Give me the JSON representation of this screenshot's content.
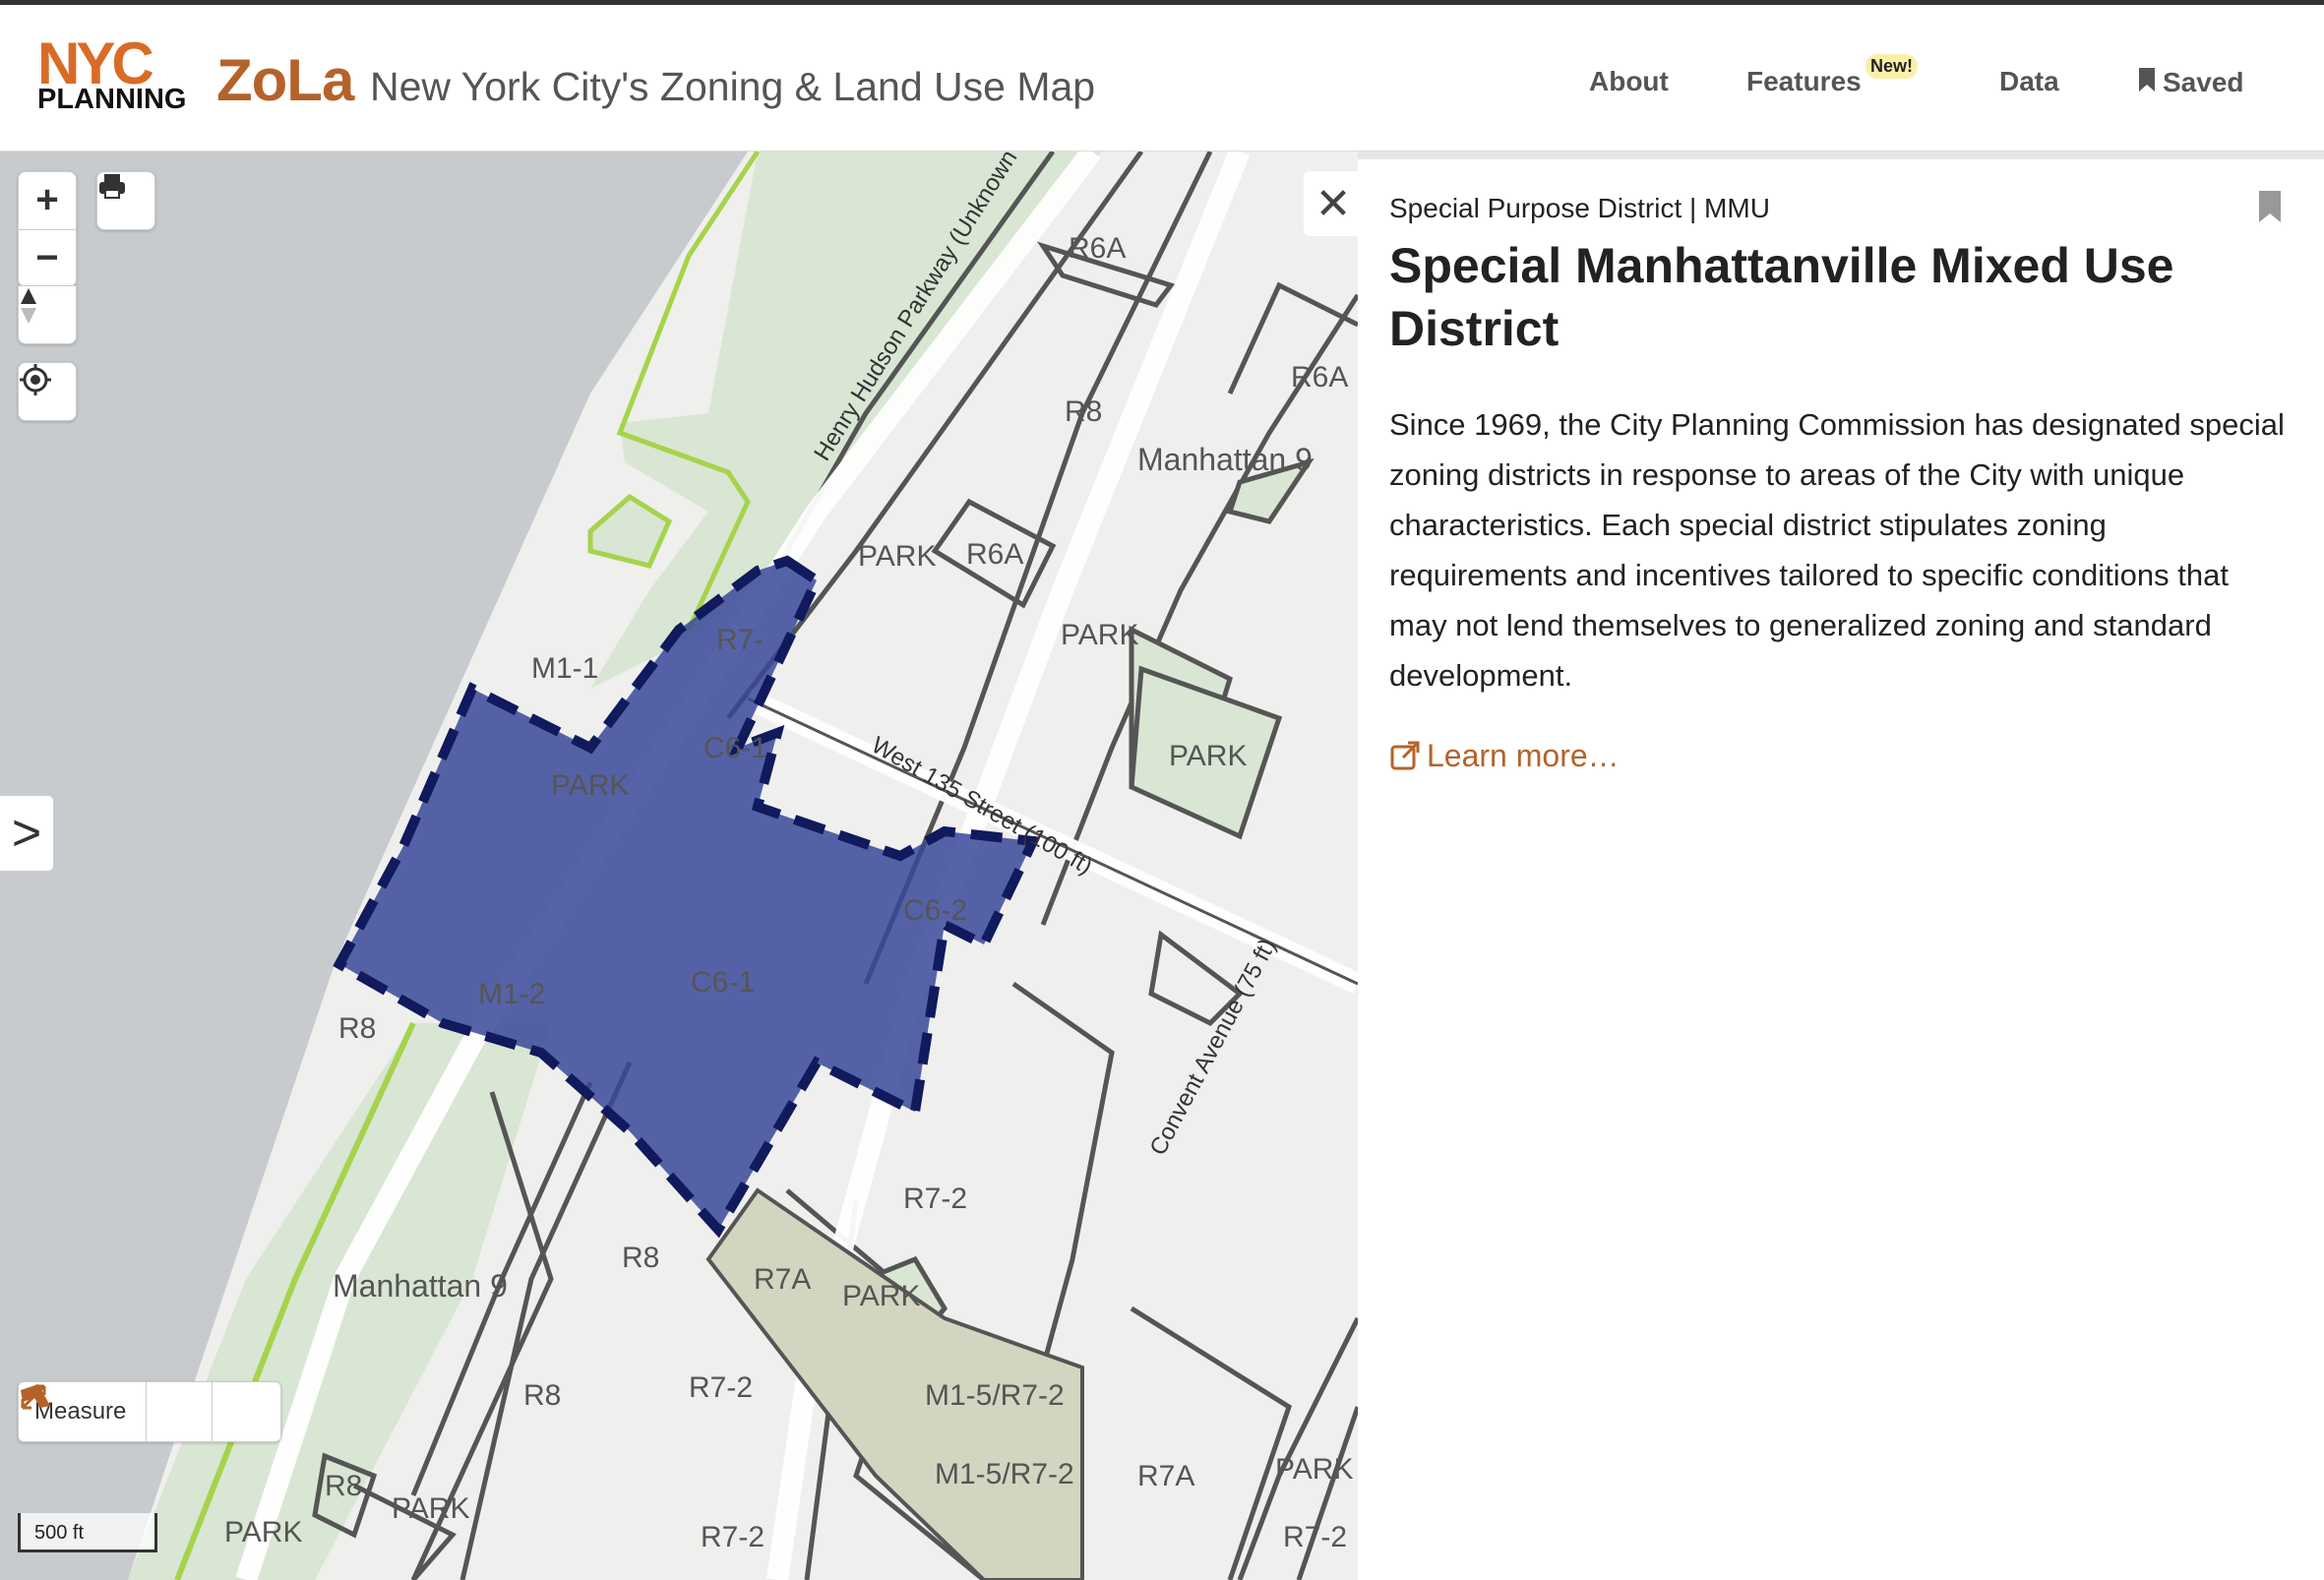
{
  "header": {
    "logo_nyc": "NYC",
    "logo_planning": "PLANNING",
    "app_name": "ZoLa",
    "app_subtitle": "New York City's Zoning & Land Use Map",
    "nav": {
      "about": "About",
      "features": "Features",
      "features_badge": "New!",
      "data": "Data",
      "saved": "Saved"
    }
  },
  "map": {
    "controls": {
      "zoom_in": "+",
      "zoom_out": "−",
      "side_toggle": ">"
    },
    "measure": {
      "label": "Measure"
    },
    "scale": "500 ft",
    "labels": {
      "r6a_1": "R6A",
      "r6a_2": "R6A",
      "r6a_3": "R6A",
      "r8_1": "R8",
      "r8_2": "R8",
      "r8_3": "R8",
      "r8_4": "R8",
      "r8_5": "R8",
      "manhattan9_1": "Manhattan 9",
      "manhattan9_2": "Manhattan 9",
      "park_1": "PARK",
      "park_2": "PARK",
      "park_3": "PARK",
      "park_4": "PARK",
      "park_5": "PARK",
      "park_6": "PARK",
      "park_7": "PARK",
      "park_8": "PARK",
      "m1_1": "M1-1",
      "m1_2": "M1-2",
      "c6_1a": "C6-1",
      "c6_1b": "C6-1",
      "c6_2": "C6-2",
      "r7_2a": "R7-2",
      "r7_2b": "R7-2",
      "r7_2c": "R7-2",
      "r7_2d": "R7-2",
      "r7_top": "R7-",
      "r7a_1": "R7A",
      "r7a_2": "R7A",
      "m15_1": "M1-5/R7-2",
      "m15_2": "M1-5/R7-2",
      "hhp": "Henry Hudson Parkway  (Unknown",
      "w135": "West 135 Street  (100 ft)",
      "convent": "Convent Avenue  (75 ft)"
    },
    "colors": {
      "district_fill": "#3a4899",
      "district_border": "#101a5c",
      "park_fill": "#d8e6d3",
      "river": "#c8cbce"
    }
  },
  "panel": {
    "eyebrow": "Special Purpose District | MMU",
    "title": "Special Manhattanville Mixed Use District",
    "description": "Since 1969, the City Planning Commission has designated special zoning districts in response to areas of the City with unique characteristics. Each special district stipulates zoning requirements and incentives tailored to specific conditions that may not lend themselves to generalized zoning and standard development.",
    "learn_more": "Learn more…",
    "close": "✕"
  }
}
